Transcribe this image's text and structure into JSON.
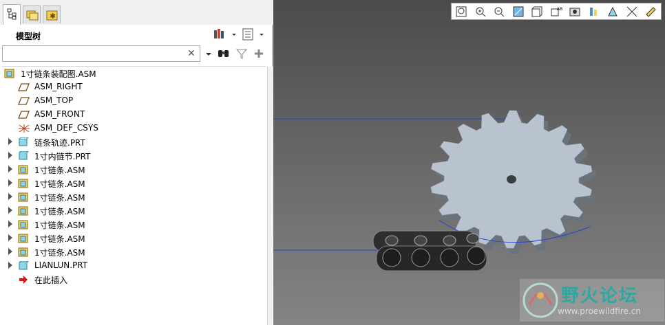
{
  "panel": {
    "header_label": "模型树",
    "search": {
      "value": "",
      "placeholder": "",
      "clear_glyph": "✕"
    }
  },
  "tree": [
    {
      "label": "1寸链条装配图.ASM",
      "icon": "assembly-root-icon",
      "expand": false
    },
    {
      "label": "ASM_RIGHT",
      "icon": "datum-plane-icon",
      "expand": false
    },
    {
      "label": "ASM_TOP",
      "icon": "datum-plane-icon",
      "expand": false
    },
    {
      "label": "ASM_FRONT",
      "icon": "datum-plane-icon",
      "expand": false
    },
    {
      "label": "ASM_DEF_CSYS",
      "icon": "csys-icon",
      "expand": false
    },
    {
      "label": "链条轨迹.PRT",
      "icon": "part-icon",
      "expand": true
    },
    {
      "label": "1寸内链节.PRT",
      "icon": "part-icon",
      "expand": true
    },
    {
      "label": "1寸链条.ASM",
      "icon": "assembly-icon",
      "expand": true
    },
    {
      "label": "1寸链条.ASM",
      "icon": "assembly-icon",
      "expand": true
    },
    {
      "label": "1寸链条.ASM",
      "icon": "assembly-icon",
      "expand": true
    },
    {
      "label": "1寸链条.ASM",
      "icon": "assembly-icon",
      "expand": true
    },
    {
      "label": "1寸链条.ASM",
      "icon": "assembly-icon",
      "expand": true
    },
    {
      "label": "1寸链条.ASM",
      "icon": "assembly-icon",
      "expand": true
    },
    {
      "label": "1寸链条.ASM",
      "icon": "assembly-icon",
      "expand": true
    },
    {
      "label": "LIANLUN.PRT",
      "icon": "part-icon",
      "expand": true
    },
    {
      "label": "在此插入",
      "icon": "insert-here-arrow-icon",
      "expand": false
    }
  ],
  "viewport": {
    "toolbar_icons": [
      "zoom-fit-icon",
      "zoom-in-icon",
      "zoom-out-icon",
      "repaint-icon",
      "display-style-icon",
      "saved-orientations-icon",
      "view-manager-icon",
      "perspective-icon",
      "annotation-display-icon",
      "datum-display-icon",
      "spin-center-icon"
    ],
    "watermark": {
      "text": "野火论坛",
      "url": "www.proewildfire.cn"
    }
  },
  "colors": {
    "sprocket": "#b8c3cf",
    "chain": "#2c2c2c",
    "trajectory": "#2a3fd0",
    "watermark": "#2fa7a0"
  }
}
